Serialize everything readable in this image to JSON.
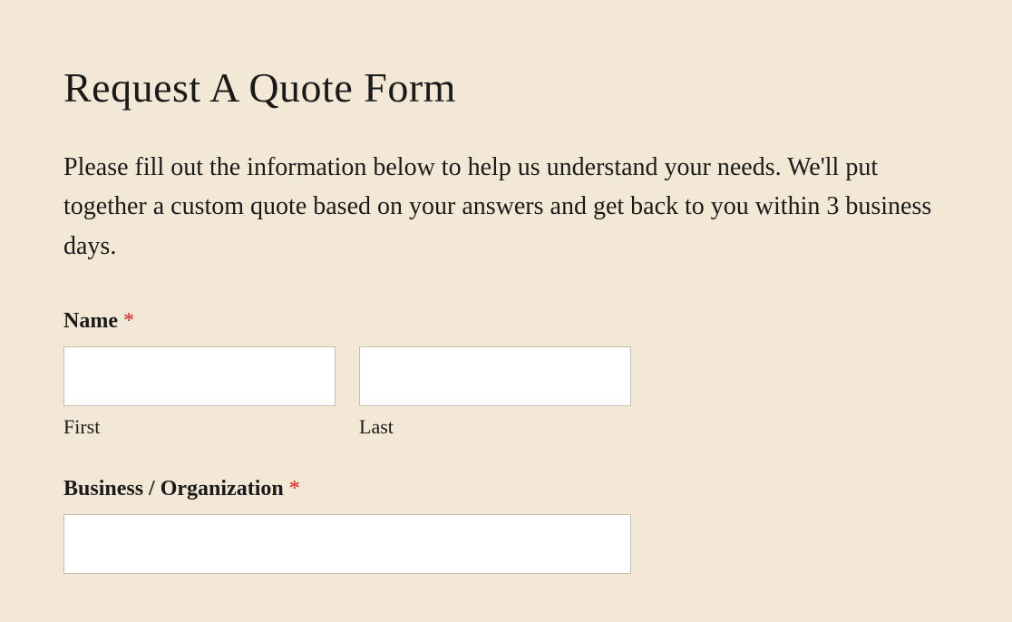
{
  "form": {
    "title": "Request A Quote Form",
    "description": "Please fill out the information below to help us understand your needs. We'll put together a custom quote based on your answers and get back to you within 3 business days.",
    "required_mark": "*",
    "fields": {
      "name": {
        "label": "Name ",
        "first": {
          "value": "",
          "sublabel": "First"
        },
        "last": {
          "value": "",
          "sublabel": "Last"
        }
      },
      "organization": {
        "label": "Business / Organization ",
        "value": ""
      }
    }
  }
}
